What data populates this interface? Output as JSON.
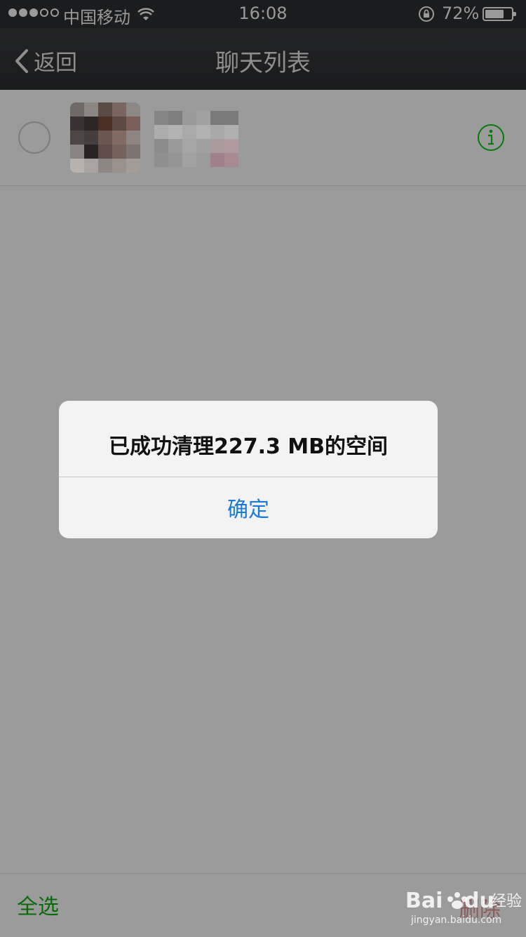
{
  "status": {
    "carrier": "中国移动",
    "time": "16:08",
    "battery_pct": "72%",
    "battery_level": 0.72
  },
  "nav": {
    "back_label": "返回",
    "title": "聊天列表"
  },
  "alert": {
    "message": "已成功清理227.3 MB的空间",
    "confirm_label": "确定"
  },
  "bottom": {
    "select_all_label": "全选",
    "delete_label": "删除"
  },
  "watermark": {
    "text": "Bai du 经验 jingyan.baidu.com"
  },
  "colors": {
    "accent_green": "#0a6a0a",
    "accent_blue": "#1a7ad8",
    "overlay_bg": "#9b9b9b"
  }
}
